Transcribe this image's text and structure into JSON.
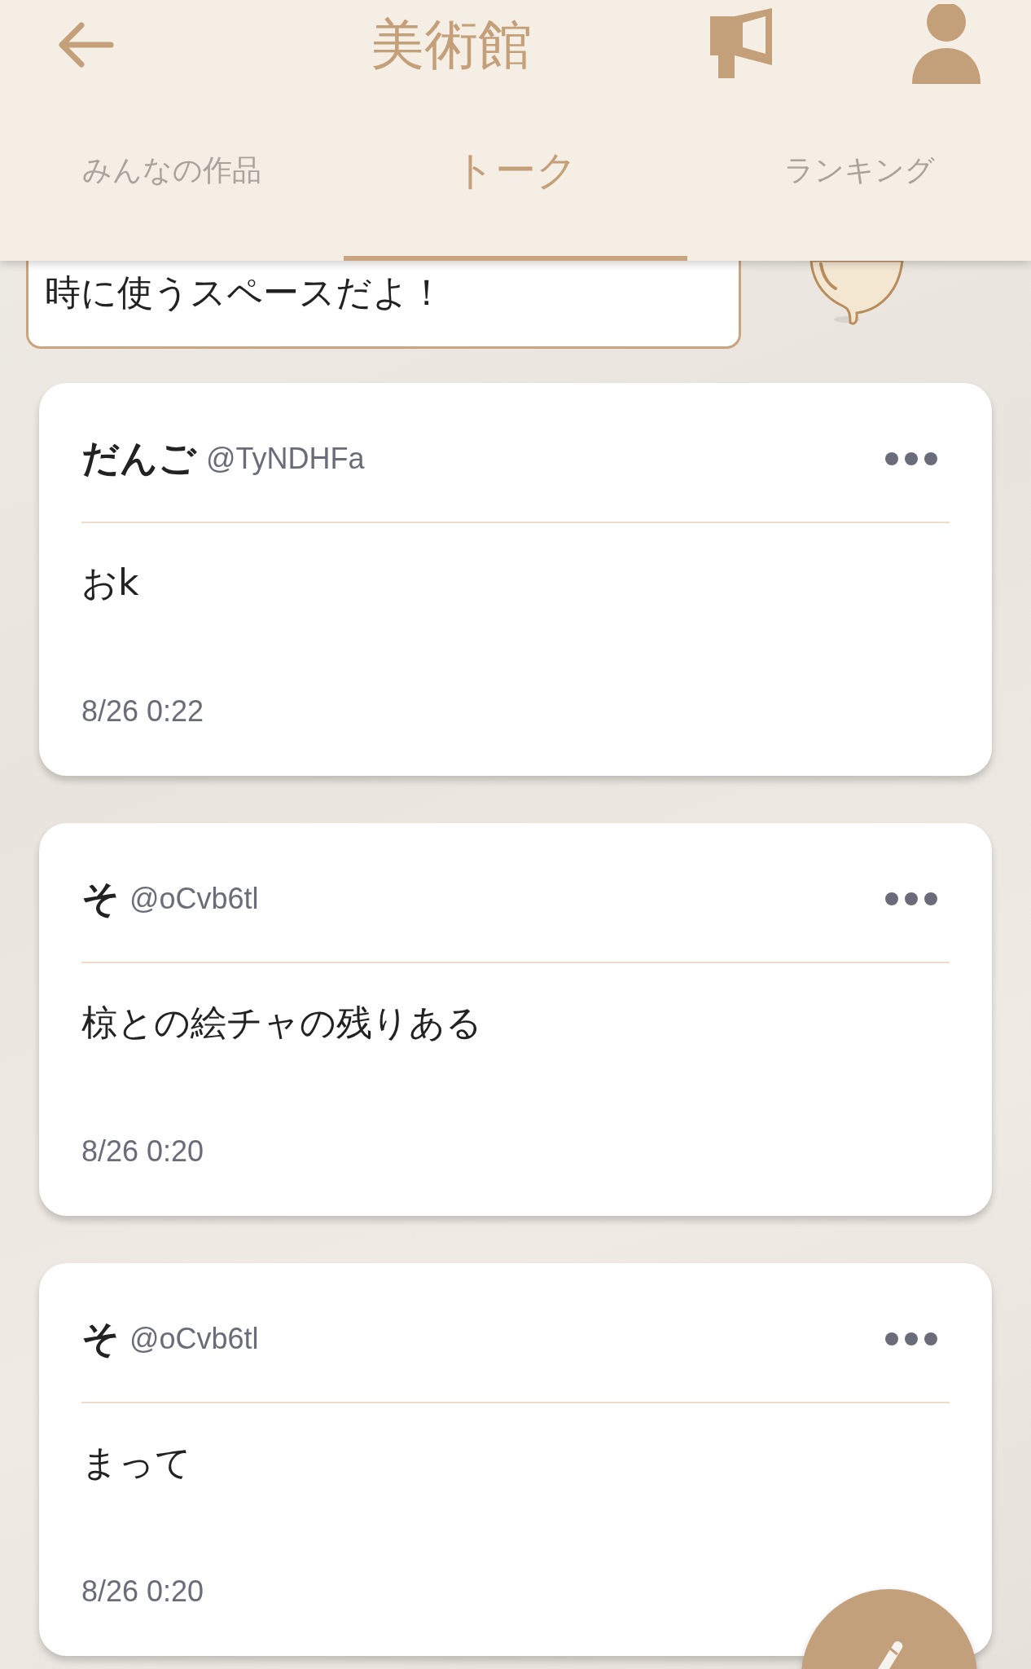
{
  "header": {
    "title": "美術館"
  },
  "tabs": [
    {
      "label": "みんなの作品",
      "selected": false
    },
    {
      "label": "トーク",
      "selected": true
    },
    {
      "label": "ランキング",
      "selected": false
    }
  ],
  "notice": {
    "text": "時に使うスペースだよ！"
  },
  "posts": [
    {
      "name": "だんご",
      "handle": "@TyNDHFa",
      "body": "おk",
      "time": "8/26 0:22"
    },
    {
      "name": "そ",
      "handle": "@oCvb6tl",
      "body": "椋との絵チャの残りある",
      "time": "8/26 0:20"
    },
    {
      "name": "そ",
      "handle": "@oCvb6tl",
      "body": "まって",
      "time": "8/26 0:20"
    }
  ]
}
